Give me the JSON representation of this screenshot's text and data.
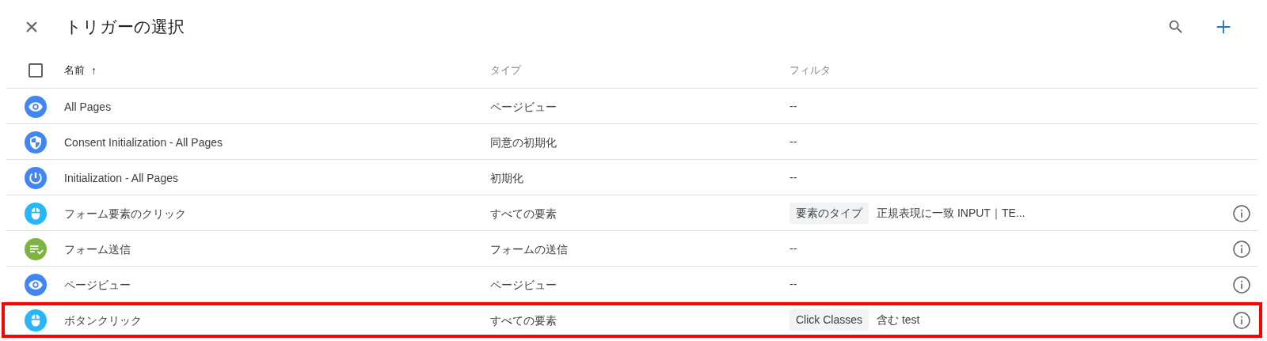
{
  "header": {
    "close": "×",
    "title": "トリガーの選択"
  },
  "table": {
    "select_all": {
      "checked": false
    },
    "columns": [
      {
        "label": "名前",
        "sort_arrow": "↑"
      },
      {
        "label": "タイプ"
      },
      {
        "label": "フィルタ"
      }
    ],
    "rows": [
      {
        "kind": "pageview",
        "color": "#4285f4",
        "name": "All Pages",
        "type": "ページビュー",
        "filter": {
          "text": "--"
        },
        "info": false,
        "highlighted": false
      },
      {
        "kind": "consent",
        "color": "#4285f4",
        "name": "Consent Initialization - All Pages",
        "type": "同意の初期化",
        "filter": {
          "text": "--"
        },
        "info": false,
        "highlighted": false
      },
      {
        "kind": "initialization",
        "color": "#4285f4",
        "name": "Initialization - All Pages",
        "type": "初期化",
        "filter": {
          "text": "--"
        },
        "info": false,
        "highlighted": false
      },
      {
        "kind": "click",
        "color": "#29b6f6",
        "name": "フォーム要素のクリック",
        "type": "すべての要素",
        "filter": {
          "chip": "要素のタイプ",
          "text": "正規表現に一致 INPUT｜TE..."
        },
        "info": true,
        "highlighted": false
      },
      {
        "kind": "submit",
        "color": "#7cb342",
        "name": "フォーム送信",
        "type": "フォームの送信",
        "filter": {
          "text": "--"
        },
        "info": true,
        "highlighted": false
      },
      {
        "kind": "pageview",
        "color": "#4285f4",
        "name": "ページビュー",
        "type": "ページビュー",
        "filter": {
          "text": "--"
        },
        "info": true,
        "highlighted": false
      },
      {
        "kind": "click",
        "color": "#29b6f6",
        "name": "ボタンクリック",
        "type": "すべての要素",
        "filter": {
          "chip": "Click Classes",
          "text": "含む test"
        },
        "info": true,
        "highlighted": true
      }
    ]
  }
}
